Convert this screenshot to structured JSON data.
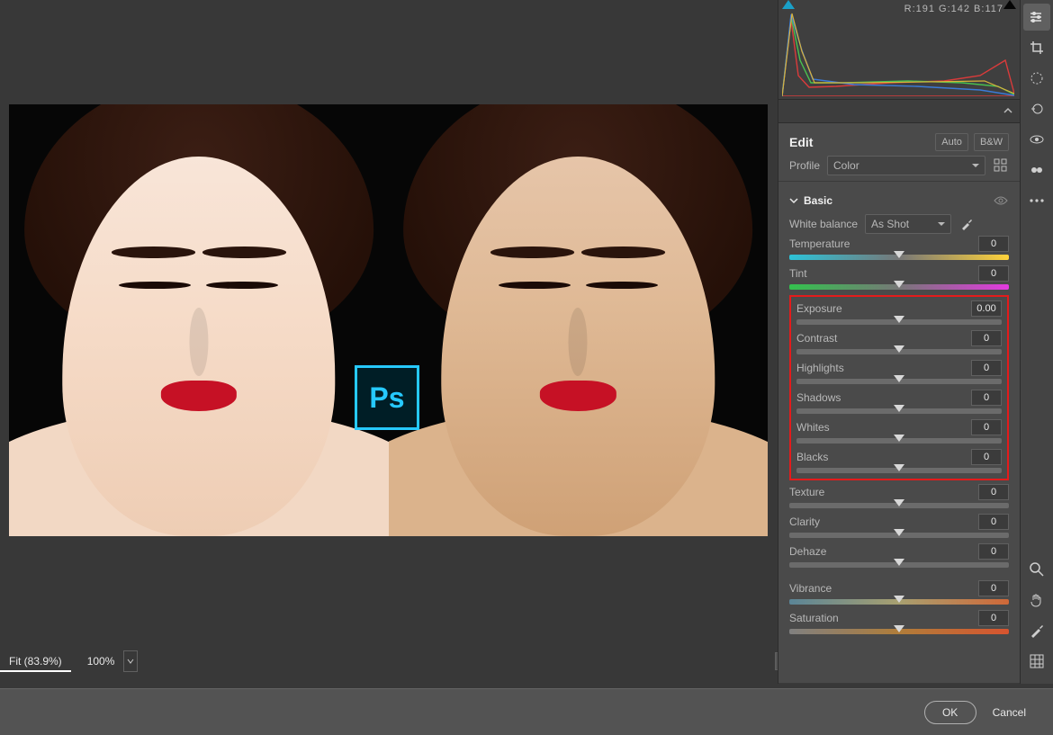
{
  "histogram": {
    "r": 191,
    "g": 142,
    "b": 117,
    "rgb_label": "R:191   G:142   B:117"
  },
  "edit": {
    "title": "Edit",
    "auto": "Auto",
    "bw": "B&W"
  },
  "profile": {
    "label": "Profile",
    "value": "Color"
  },
  "basic": {
    "title": "Basic",
    "wb_label": "White balance",
    "wb_value": "As Shot",
    "sliders": {
      "temperature": {
        "label": "Temperature",
        "value": "0"
      },
      "tint": {
        "label": "Tint",
        "value": "0"
      },
      "exposure": {
        "label": "Exposure",
        "value": "0.00"
      },
      "contrast": {
        "label": "Contrast",
        "value": "0"
      },
      "highlights": {
        "label": "Highlights",
        "value": "0"
      },
      "shadows": {
        "label": "Shadows",
        "value": "0"
      },
      "whites": {
        "label": "Whites",
        "value": "0"
      },
      "blacks": {
        "label": "Blacks",
        "value": "0"
      },
      "texture": {
        "label": "Texture",
        "value": "0"
      },
      "clarity": {
        "label": "Clarity",
        "value": "0"
      },
      "dehaze": {
        "label": "Dehaze",
        "value": "0"
      },
      "vibrance": {
        "label": "Vibrance",
        "value": "0"
      },
      "saturation": {
        "label": "Saturation",
        "value": "0"
      }
    }
  },
  "viewbar": {
    "fit": "Fit (83.9%)",
    "hundred": "100%"
  },
  "dialog": {
    "ok": "OK",
    "cancel": "Cancel"
  },
  "ps_logo": "Ps"
}
